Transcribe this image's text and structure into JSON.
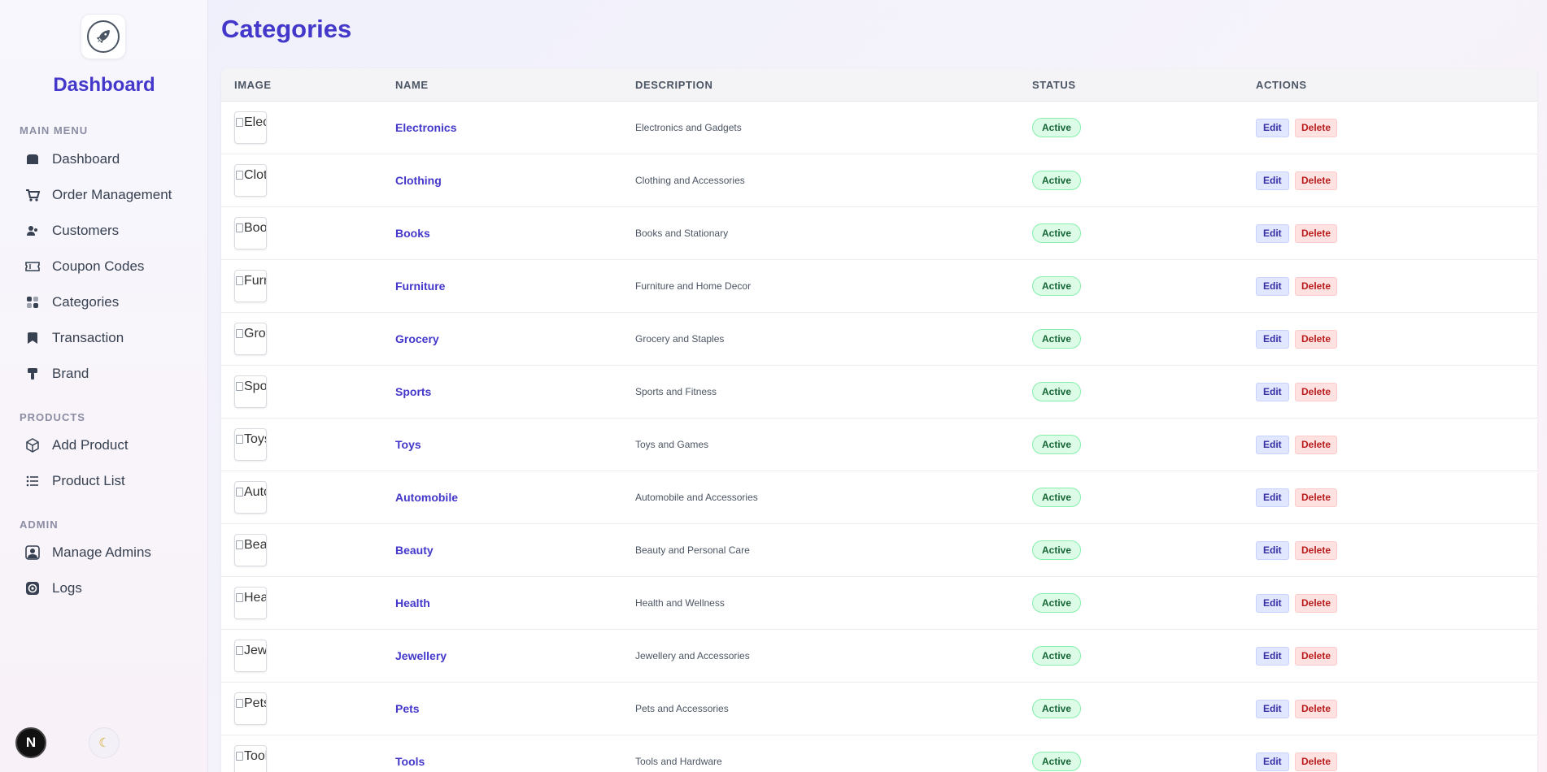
{
  "sidebar": {
    "title": "Dashboard",
    "sections": {
      "main_menu": "MAIN MENU",
      "products": "PRODUCTS",
      "admin": "ADMIN"
    },
    "items": [
      {
        "label": "Dashboard",
        "icon": "dashboard-icon"
      },
      {
        "label": "Order Management",
        "icon": "cart-icon"
      },
      {
        "label": "Customers",
        "icon": "users-icon"
      },
      {
        "label": "Coupon Codes",
        "icon": "ticket-icon"
      },
      {
        "label": "Categories",
        "icon": "grid-icon"
      },
      {
        "label": "Transaction",
        "icon": "bookmark-icon"
      },
      {
        "label": "Brand",
        "icon": "paint-roller-icon"
      },
      {
        "label": "Add Product",
        "icon": "box-icon"
      },
      {
        "label": "Product List",
        "icon": "list-icon"
      },
      {
        "label": "Manage Admins",
        "icon": "admin-user-icon"
      },
      {
        "label": "Logs",
        "icon": "log-circle-icon"
      }
    ],
    "avatar_letter": "N",
    "theme_icon": "moon-icon"
  },
  "main": {
    "title": "Categories",
    "columns": [
      "IMAGE",
      "NAME",
      "DESCRIPTION",
      "STATUS",
      "ACTIONS"
    ],
    "edit_label": "Edit",
    "delete_label": "Delete",
    "rows": [
      {
        "img_alt": "Elec",
        "name": "Electronics",
        "description": "Electronics and Gadgets",
        "status": "Active"
      },
      {
        "img_alt": "Clot",
        "name": "Clothing",
        "description": "Clothing and Accessories",
        "status": "Active"
      },
      {
        "img_alt": "Book",
        "name": "Books",
        "description": "Books and Stationary",
        "status": "Active"
      },
      {
        "img_alt": "Furn",
        "name": "Furniture",
        "description": "Furniture and Home Decor",
        "status": "Active"
      },
      {
        "img_alt": "Groc",
        "name": "Grocery",
        "description": "Grocery and Staples",
        "status": "Active"
      },
      {
        "img_alt": "Spor",
        "name": "Sports",
        "description": "Sports and Fitness",
        "status": "Active"
      },
      {
        "img_alt": "Toys",
        "name": "Toys",
        "description": "Toys and Games",
        "status": "Active"
      },
      {
        "img_alt": "Auto",
        "name": "Automobile",
        "description": "Automobile and Accessories",
        "status": "Active"
      },
      {
        "img_alt": "Beau",
        "name": "Beauty",
        "description": "Beauty and Personal Care",
        "status": "Active"
      },
      {
        "img_alt": "Heal",
        "name": "Health",
        "description": "Health and Wellness",
        "status": "Active"
      },
      {
        "img_alt": "Jewe",
        "name": "Jewellery",
        "description": "Jewellery and Accessories",
        "status": "Active"
      },
      {
        "img_alt": "Pets",
        "name": "Pets",
        "description": "Pets and Accessories",
        "status": "Active"
      },
      {
        "img_alt": "Tool",
        "name": "Tools",
        "description": "Tools and Hardware",
        "status": "Active"
      }
    ]
  }
}
